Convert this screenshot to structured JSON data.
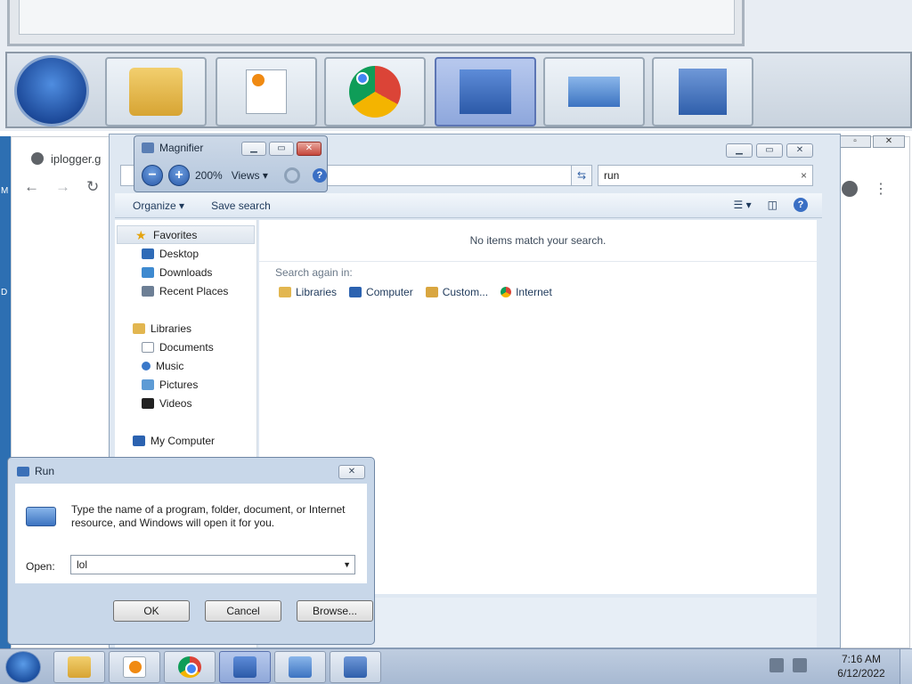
{
  "chrome": {
    "tab_title": "iplogger.g"
  },
  "desktop": {
    "icon_letters": [
      "M",
      "D"
    ]
  },
  "explorer": {
    "search_value": "run",
    "clear_glyph": "×",
    "toolbar": {
      "organize": "Organize ▾",
      "save_search": "Save search",
      "help": "?"
    },
    "nav": {
      "favorites": "Favorites",
      "desktop": "Desktop",
      "downloads": "Downloads",
      "recent_places": "Recent Places",
      "libraries": "Libraries",
      "documents": "Documents",
      "music": "Music",
      "pictures": "Pictures",
      "videos": "Videos",
      "my_computer": "My Computer"
    },
    "empty_message": "No items match your search.",
    "search_again_label": "Search again in:",
    "search_again": [
      "Libraries",
      "Computer",
      "Custom...",
      "Internet"
    ]
  },
  "magnifier": {
    "title": "Magnifier",
    "zoom": "200%",
    "views": "Views ▾",
    "minus": "−",
    "plus": "+",
    "help": "?"
  },
  "run": {
    "title": "Run",
    "description": "Type the name of a program, folder, document, or Internet resource, and Windows will open it for you.",
    "open_label": "Open:",
    "open_value": "lol",
    "ok": "OK",
    "cancel": "Cancel",
    "browse": "Browse..."
  },
  "taskbar": {
    "clock_time": "7:16 AM",
    "clock_date": "6/12/2022",
    "apps": [
      "windows-explorer",
      "media-player",
      "chrome",
      "display-settings",
      "run",
      "magnifier"
    ]
  },
  "colors": {
    "taskbar": "#a7b9d2",
    "desktop": "#2d6fb2",
    "explorer_frame": "#dfe8f2"
  }
}
